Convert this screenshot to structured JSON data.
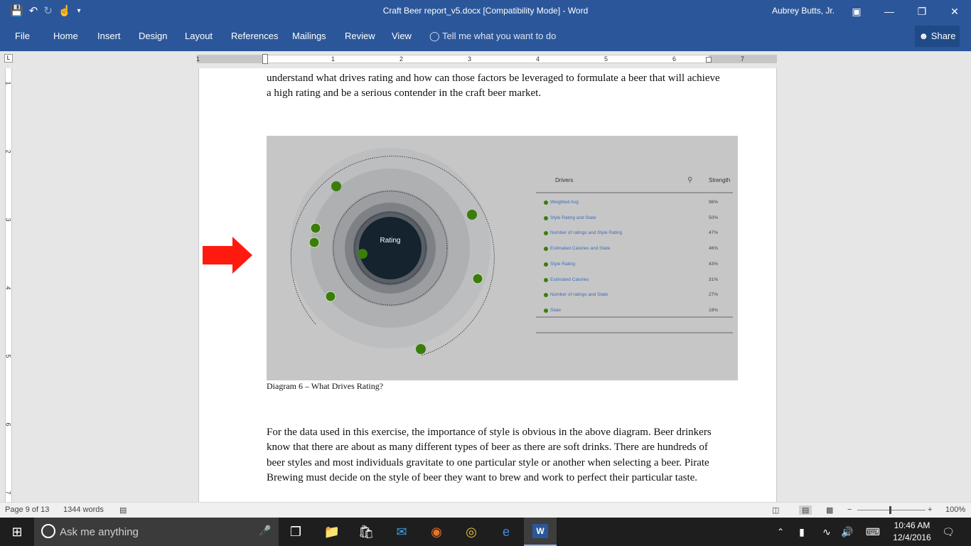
{
  "window": {
    "title": "Craft Beer report_v5.docx [Compatibility Mode] - Word",
    "user": "Aubrey Butts, Jr.",
    "share_label": "Share"
  },
  "ribbon": {
    "tabs": [
      "File",
      "Home",
      "Insert",
      "Design",
      "Layout",
      "References",
      "Mailings",
      "Review",
      "View"
    ],
    "tell_me": "Tell me what you want to do"
  },
  "ruler": {
    "h_numbers": [
      "1",
      "1",
      "2",
      "3",
      "4",
      "5",
      "6",
      "7"
    ],
    "v_numbers": [
      "1",
      "2",
      "3",
      "4",
      "5",
      "6",
      "7"
    ]
  },
  "document": {
    "para1": "understand what drives rating and how can those factors be leveraged to formulate a beer that will achieve a high rating and be a serious contender in the craft beer market.",
    "caption": "Diagram 6 – What Drives Rating?",
    "para2": "For the data used in this exercise, the importance of style is obvious in the above diagram.  Beer drinkers know that there are about as many different types of beer as there are soft drinks.  There are hundreds of beer styles and most individuals gravitate to one particular style or another when selecting a beer.  Pirate Brewing must decide on the style of beer they want to brew and work to perfect their particular taste."
  },
  "diagram": {
    "center_label": "Rating",
    "col_drivers": "Drivers",
    "col_strength": "Strength",
    "drivers": [
      {
        "name": "Weighted Avg",
        "strength": "96%"
      },
      {
        "name": "Style Rating and State",
        "strength": "50%"
      },
      {
        "name": "Number of ratings and Style Rating",
        "strength": "47%"
      },
      {
        "name": "Estimated Calories and State",
        "strength": "46%"
      },
      {
        "name": "Style Rating",
        "strength": "43%"
      },
      {
        "name": "Estimated Calories",
        "strength": "31%"
      },
      {
        "name": "Number of ratings and State",
        "strength": "27%"
      },
      {
        "name": "State",
        "strength": "18%"
      }
    ],
    "colors": {
      "dot": "#3b7d0a",
      "core": "#14232e",
      "link": "#3b6fb6"
    }
  },
  "statusbar": {
    "page": "Page 9 of 13",
    "words": "1344 words",
    "zoom": "100%"
  },
  "taskbar": {
    "search_placeholder": "Ask me anything",
    "time": "10:46 AM",
    "date": "12/4/2016"
  }
}
